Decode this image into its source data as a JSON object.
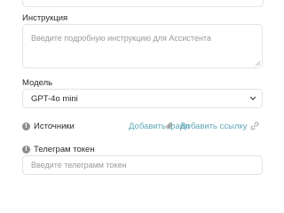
{
  "instruction": {
    "label": "Инструкция",
    "placeholder": "Введите подробную инструкцию для Ассистента"
  },
  "model": {
    "label": "Модель",
    "selected": "GPT-4o mini"
  },
  "sources": {
    "label": "Источники",
    "add_file": "Добавить файл",
    "add_link": "Добавить ссылку"
  },
  "telegram": {
    "label": "Телеграм токен",
    "placeholder": "Введите телеграмм токен"
  },
  "icons": {
    "info": "info-icon",
    "attach": "paperclip-icon",
    "link": "link-icon",
    "dropdown": "chevron-down-icon"
  },
  "colors": {
    "accent": "#5ea8b9",
    "border": "#e2e2e2",
    "placeholder": "#9a9a9a",
    "info_icon": "#8c8c8c"
  }
}
